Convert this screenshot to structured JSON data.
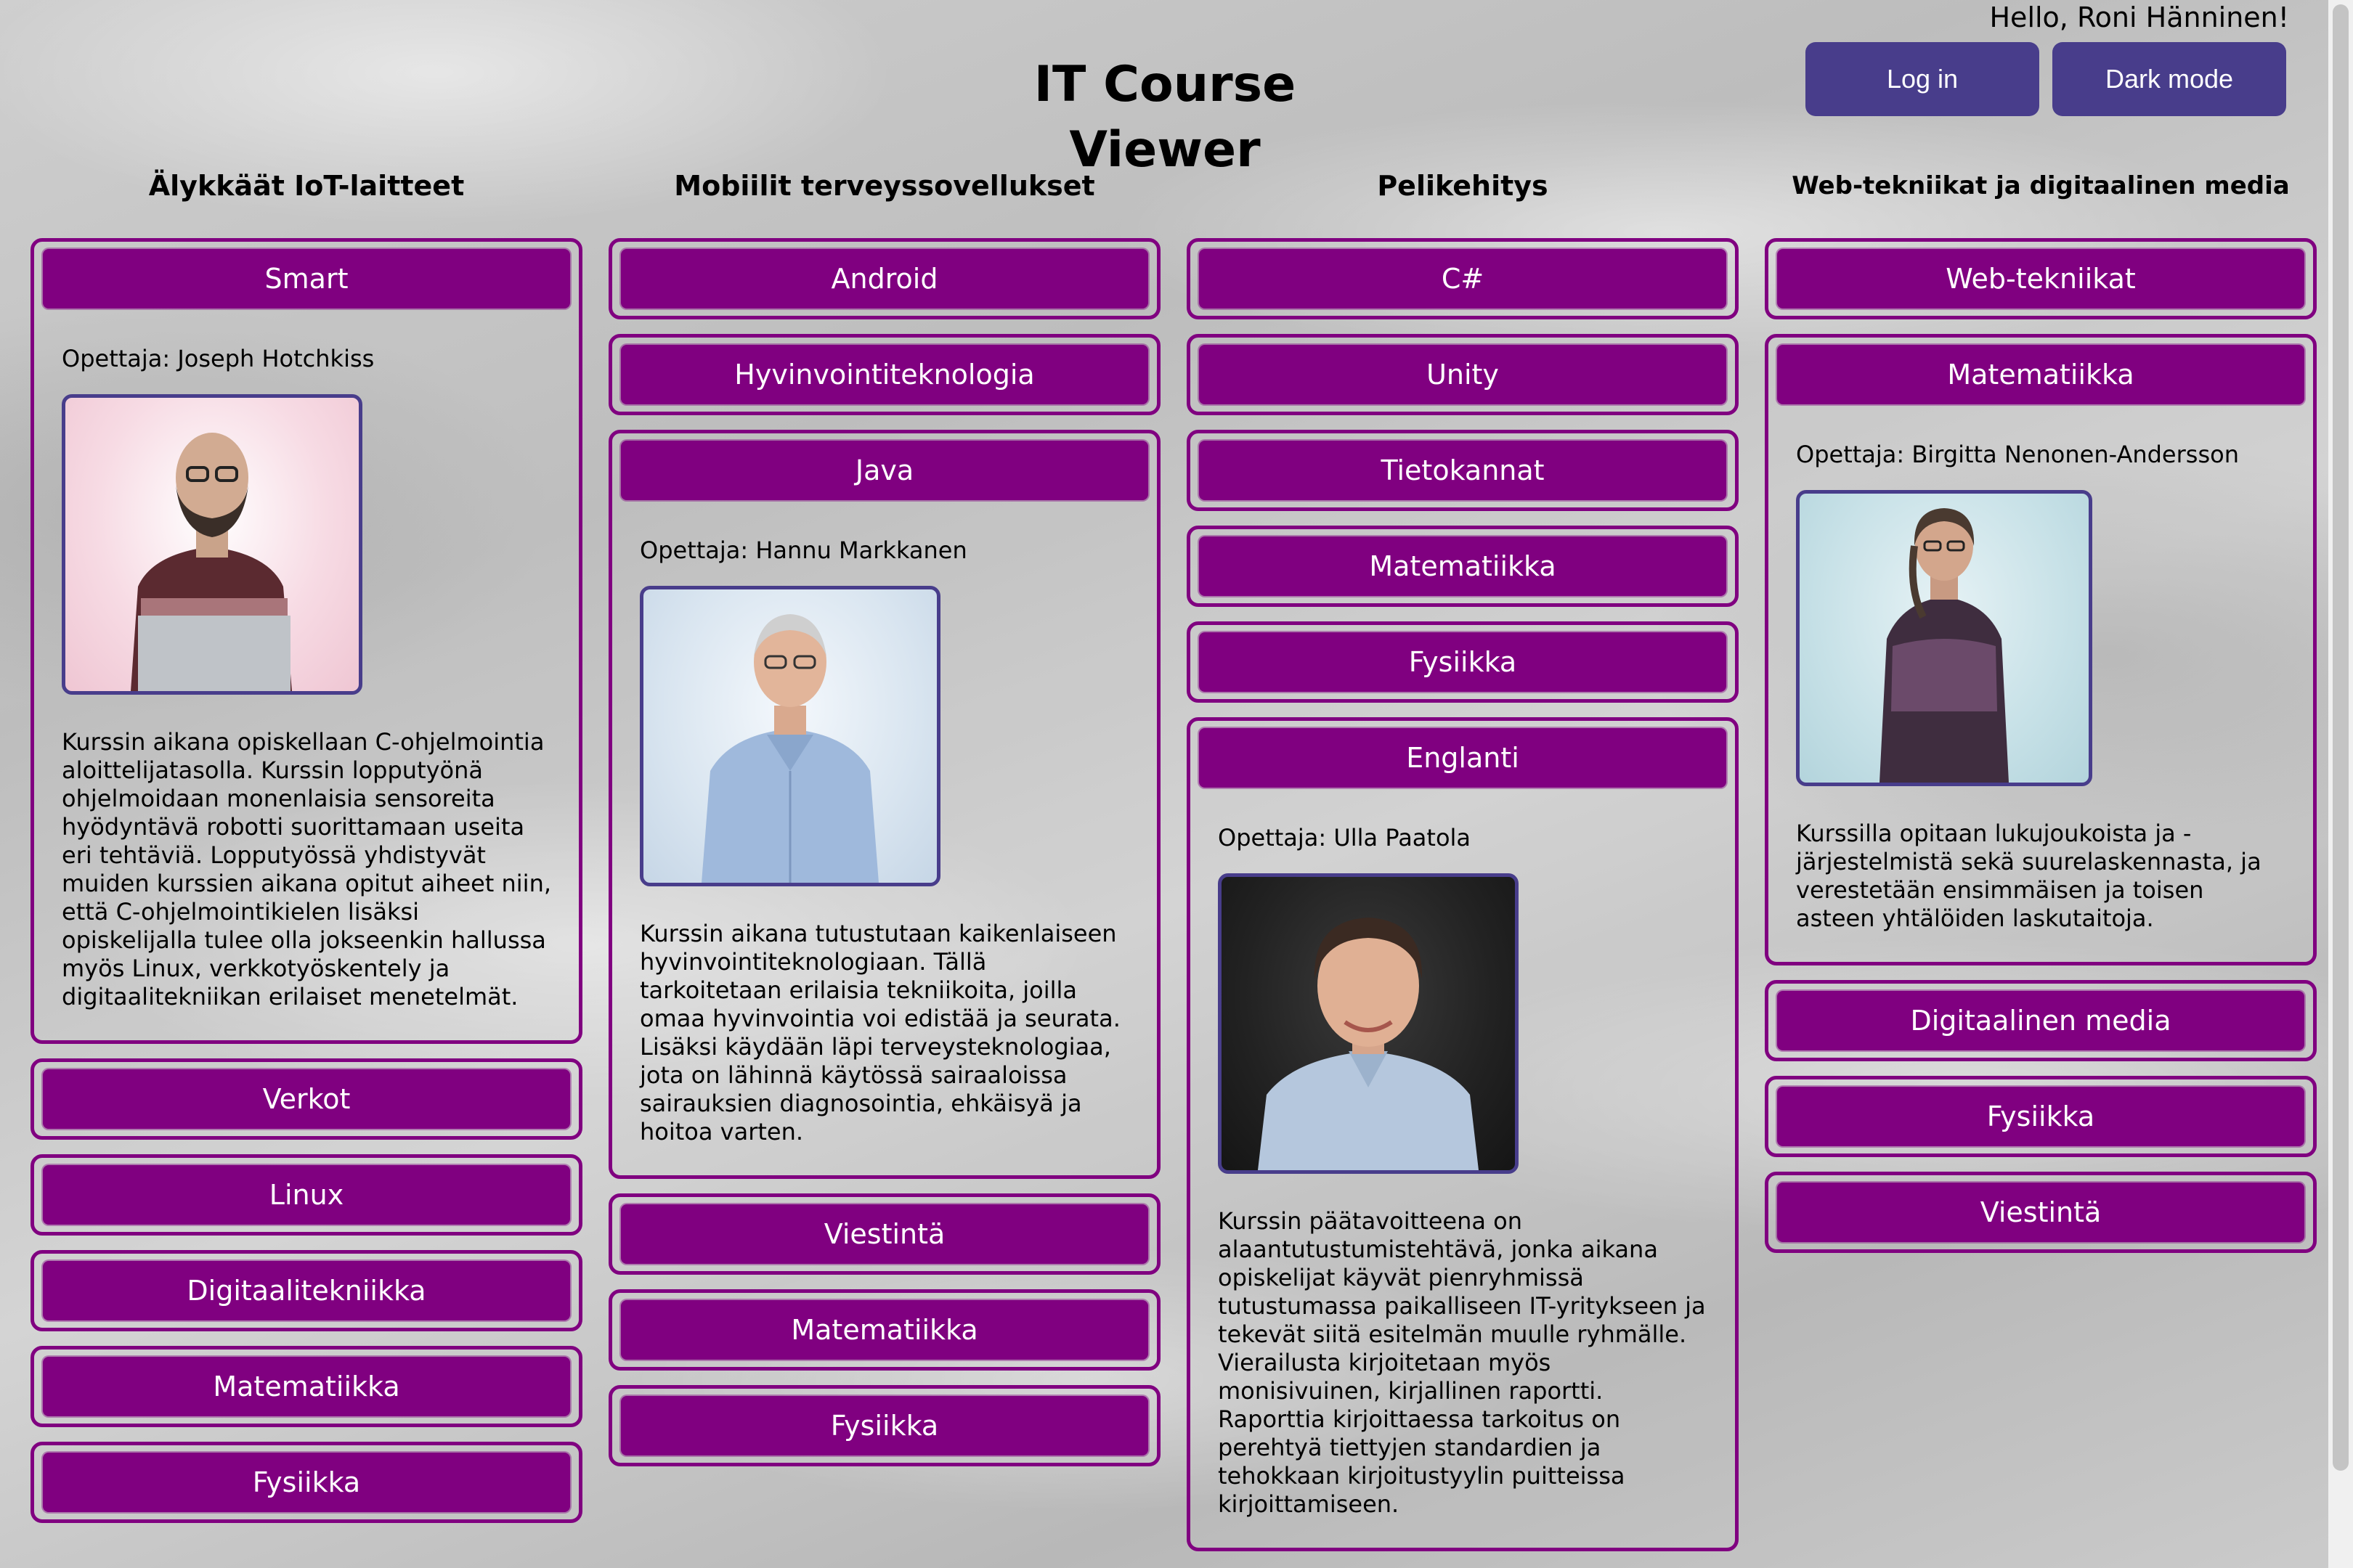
{
  "header": {
    "title": "IT Course Viewer",
    "greeting": "Hello, Roni Hänninen!",
    "login_label": "Log in",
    "darkmode_label": "Dark mode"
  },
  "colors": {
    "accent_purple": "#800080",
    "header_button": "#483d8b"
  },
  "columns": [
    {
      "title": "Älykkäät IoT-laitteet",
      "courses": [
        {
          "name": "Smart",
          "expanded": true,
          "teacher": "Opettaja: Joseph Hotchkiss",
          "photo": "teacher-photo-joseph-hotchkiss",
          "description": "Kurssin aikana opiskellaan C-ohjelmointia aloittelijatasolla. Kurssin lopputyönä ohjelmoidaan monenlaisia sensoreita hyödyntävä robotti suorittamaan useita eri tehtäviä. Lopputyössä yhdistyvät muiden kurssien aikana opitut aiheet niin, että C-ohjelmointikielen lisäksi opiskelijalla tulee olla jokseenkin hallussa myös Linux, verkkotyöskentely ja digitaalitekniikan erilaiset menetelmät."
        },
        {
          "name": "Verkot"
        },
        {
          "name": "Linux"
        },
        {
          "name": "Digitaalitekniikka"
        },
        {
          "name": "Matematiikka"
        },
        {
          "name": "Fysiikka"
        }
      ]
    },
    {
      "title": "Mobiilit terveyssovellukset",
      "courses": [
        {
          "name": "Android"
        },
        {
          "name": "Hyvinvointiteknologia"
        },
        {
          "name": "Java",
          "expanded": true,
          "teacher": "Opettaja: Hannu Markkanen",
          "photo": "teacher-photo-hannu-markkanen",
          "description": "Kurssin aikana tutustutaan kaikenlaiseen hyvinvointiteknologiaan. Tällä tarkoitetaan erilaisia tekniikoita, joilla omaa hyvinvointia voi edistää ja seurata. Lisäksi käydään läpi terveysteknologiaa, jota on lähinnä käytössä sairaaloissa sairauksien diagnosointia, ehkäisyä ja hoitoa varten."
        },
        {
          "name": "Viestintä"
        },
        {
          "name": "Matematiikka"
        },
        {
          "name": "Fysiikka"
        }
      ]
    },
    {
      "title": "Pelikehitys",
      "courses": [
        {
          "name": "C#"
        },
        {
          "name": "Unity"
        },
        {
          "name": "Tietokannat"
        },
        {
          "name": "Matematiikka"
        },
        {
          "name": "Fysiikka"
        },
        {
          "name": "Englanti",
          "expanded": true,
          "teacher": "Opettaja: Ulla Paatola",
          "photo": "teacher-photo-ulla-paatola",
          "description": "Kurssin päätavoitteena on alaantutustumistehtävä, jonka aikana opiskelijat käyvät pienryhmissä tutustumassa paikalliseen IT-yritykseen ja tekevät siitä esitelmän muulle ryhmälle. Vierailusta kirjoitetaan myös monisivuinen, kirjallinen raportti. Raporttia kirjoittaessa tarkoitus on perehtyä tiettyjen standardien ja tehokkaan kirjoitustyylin puitteissa kirjoittamiseen."
        }
      ]
    },
    {
      "title": "Web-tekniikat ja digitaalinen media",
      "courses": [
        {
          "name": "Web-tekniikat"
        },
        {
          "name": "Matematiikka",
          "expanded": true,
          "teacher": "Opettaja: Birgitta Nenonen-Andersson",
          "photo": "teacher-photo-birgitta-nenonen-andersson",
          "description": "Kurssilla opitaan lukujoukoista ja -järjestelmistä sekä suurelaskennasta, ja verestetään ensimmäisen ja toisen asteen yhtälöiden laskutaitoja."
        },
        {
          "name": "Digitaalinen media"
        },
        {
          "name": "Fysiikka"
        },
        {
          "name": "Viestintä"
        }
      ]
    }
  ]
}
